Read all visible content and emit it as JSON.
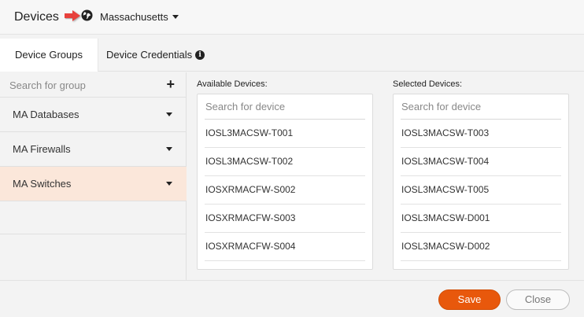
{
  "header": {
    "title": "Devices",
    "globe_icon": "globe-icon",
    "region_value": "Massachusetts"
  },
  "tabs": [
    {
      "label": "Device Groups",
      "active": true
    },
    {
      "label": "Device Credentials",
      "icon": "info-icon"
    }
  ],
  "sidebar": {
    "search_placeholder": "Search for group",
    "add_icon": "plus-icon",
    "groups": [
      {
        "label": "MA Databases"
      },
      {
        "label": "MA Firewalls"
      },
      {
        "label": "MA Switches",
        "active": true
      }
    ]
  },
  "available": {
    "label": "Available Devices:",
    "search_placeholder": "Search for device",
    "devices": [
      "IOSL3MACSW-T001",
      "IOSL3MACSW-T002",
      "IOSXRMACFW-S002",
      "IOSXRMACFW-S003",
      "IOSXRMACFW-S004"
    ]
  },
  "selected": {
    "label": "Selected Devices:",
    "search_placeholder": "Search for device",
    "devices": [
      "IOSL3MACSW-T003",
      "IOSL3MACSW-T004",
      "IOSL3MACSW-T005",
      "IOSL3MACSW-D001",
      "IOSL3MACSW-D002"
    ]
  },
  "footer": {
    "save_label": "Save",
    "close_label": "Close"
  },
  "colors": {
    "accent": "#e8580c",
    "active_group_bg": "#fbe7da",
    "callout_arrow": "#e8413c"
  }
}
